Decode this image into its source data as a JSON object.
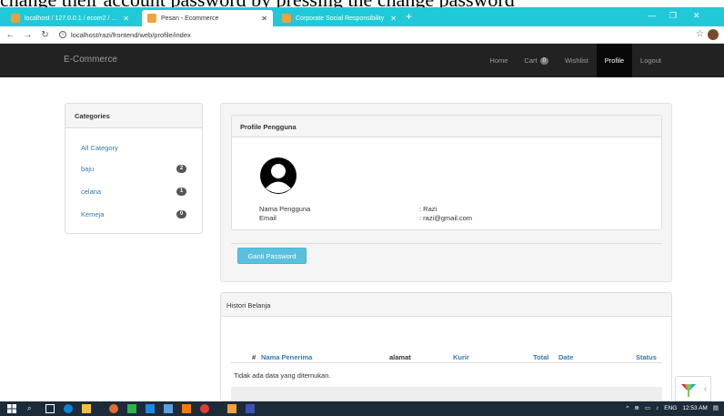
{
  "caption": "change their account password by pressing the change password",
  "browser": {
    "tabs": [
      {
        "label": "localhost / 127.0.0.1 / ecom2 / ...",
        "active": false
      },
      {
        "label": "Pesan - Ecommerce",
        "active": true
      },
      {
        "label": "Corporate Social Responsibility",
        "active": false
      }
    ],
    "new_tab": "+",
    "url": "localhost/razi/frontend/web/profile/index"
  },
  "nav": {
    "brand": "E-Commerce",
    "links": [
      {
        "label": "Home"
      },
      {
        "label": "Cart",
        "badge": "0"
      },
      {
        "label": "Wishlist"
      },
      {
        "label": "Profile",
        "active": true
      },
      {
        "label": "Logout"
      }
    ]
  },
  "categories": {
    "title": "Categories",
    "items": [
      {
        "label": "All Category",
        "count": ""
      },
      {
        "label": "baju",
        "count": "2"
      },
      {
        "label": "celana",
        "count": "1"
      },
      {
        "label": "Kemeja",
        "count": "0"
      }
    ]
  },
  "profile": {
    "title": "Profile Pengguna",
    "name_label": "Nama Pengguna",
    "name_value": ": Razi",
    "email_label": "Email",
    "email_value": ": razi@gmail.com",
    "change_password": "Ganti Password"
  },
  "history": {
    "title": "Histori Belanja",
    "columns": [
      "#",
      "Nama Penerima",
      "alamat",
      "Kurir",
      "Total",
      "Date",
      "Status"
    ],
    "empty": "Tidak ada data yang ditemukan."
  },
  "taskbar": {
    "language": "ENG",
    "time": "12:53 AM"
  },
  "colors": {
    "tabbar": "#20c9d8",
    "navbar": "#222222",
    "link": "#337ab7",
    "info_button": "#5bc0de",
    "taskbar": "#1c2b3a"
  }
}
